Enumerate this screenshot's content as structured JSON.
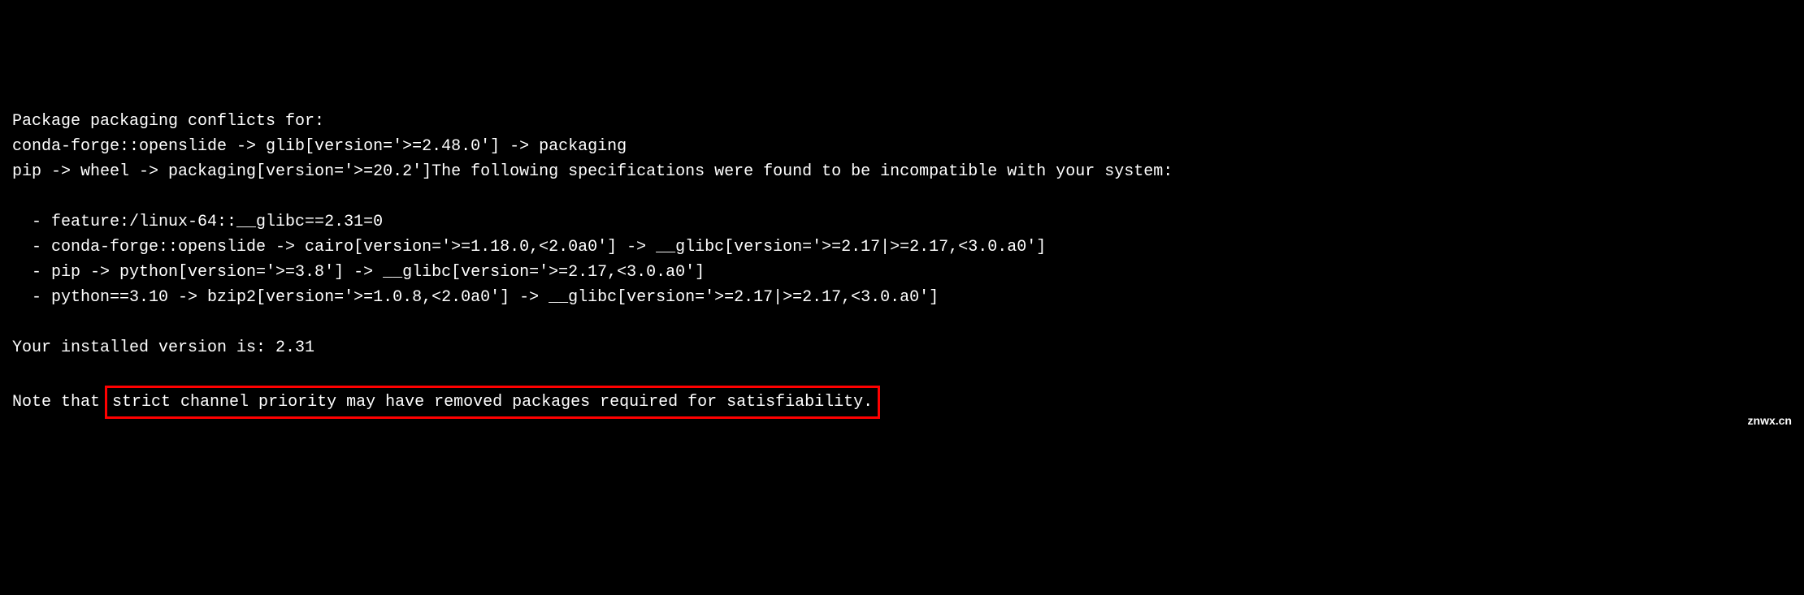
{
  "terminal": {
    "line1": "Package packaging conflicts for:",
    "line2": "conda-forge::openslide -> glib[version='>=2.48.0'] -> packaging",
    "line3": "pip -> wheel -> packaging[version='>=20.2']The following specifications were found to be incompatible with your system:",
    "line4": "",
    "line5": "  - feature:/linux-64::__glibc==2.31=0",
    "line6": "  - conda-forge::openslide -> cairo[version='>=1.18.0,<2.0a0'] -> __glibc[version='>=2.17|>=2.17,<3.0.a0']",
    "line7": "  - pip -> python[version='>=3.8'] -> __glibc[version='>=2.17,<3.0.a0']",
    "line8": "  - python==3.10 -> bzip2[version='>=1.0.8,<2.0a0'] -> __glibc[version='>=2.17|>=2.17,<3.0.a0']",
    "line9": "",
    "line10": "Your installed version is: 2.31",
    "line11": "",
    "note_prefix": "Note that ",
    "note_highlighted": "strict channel priority may have removed packages required for satisfiability."
  },
  "watermark": "znwx.cn"
}
